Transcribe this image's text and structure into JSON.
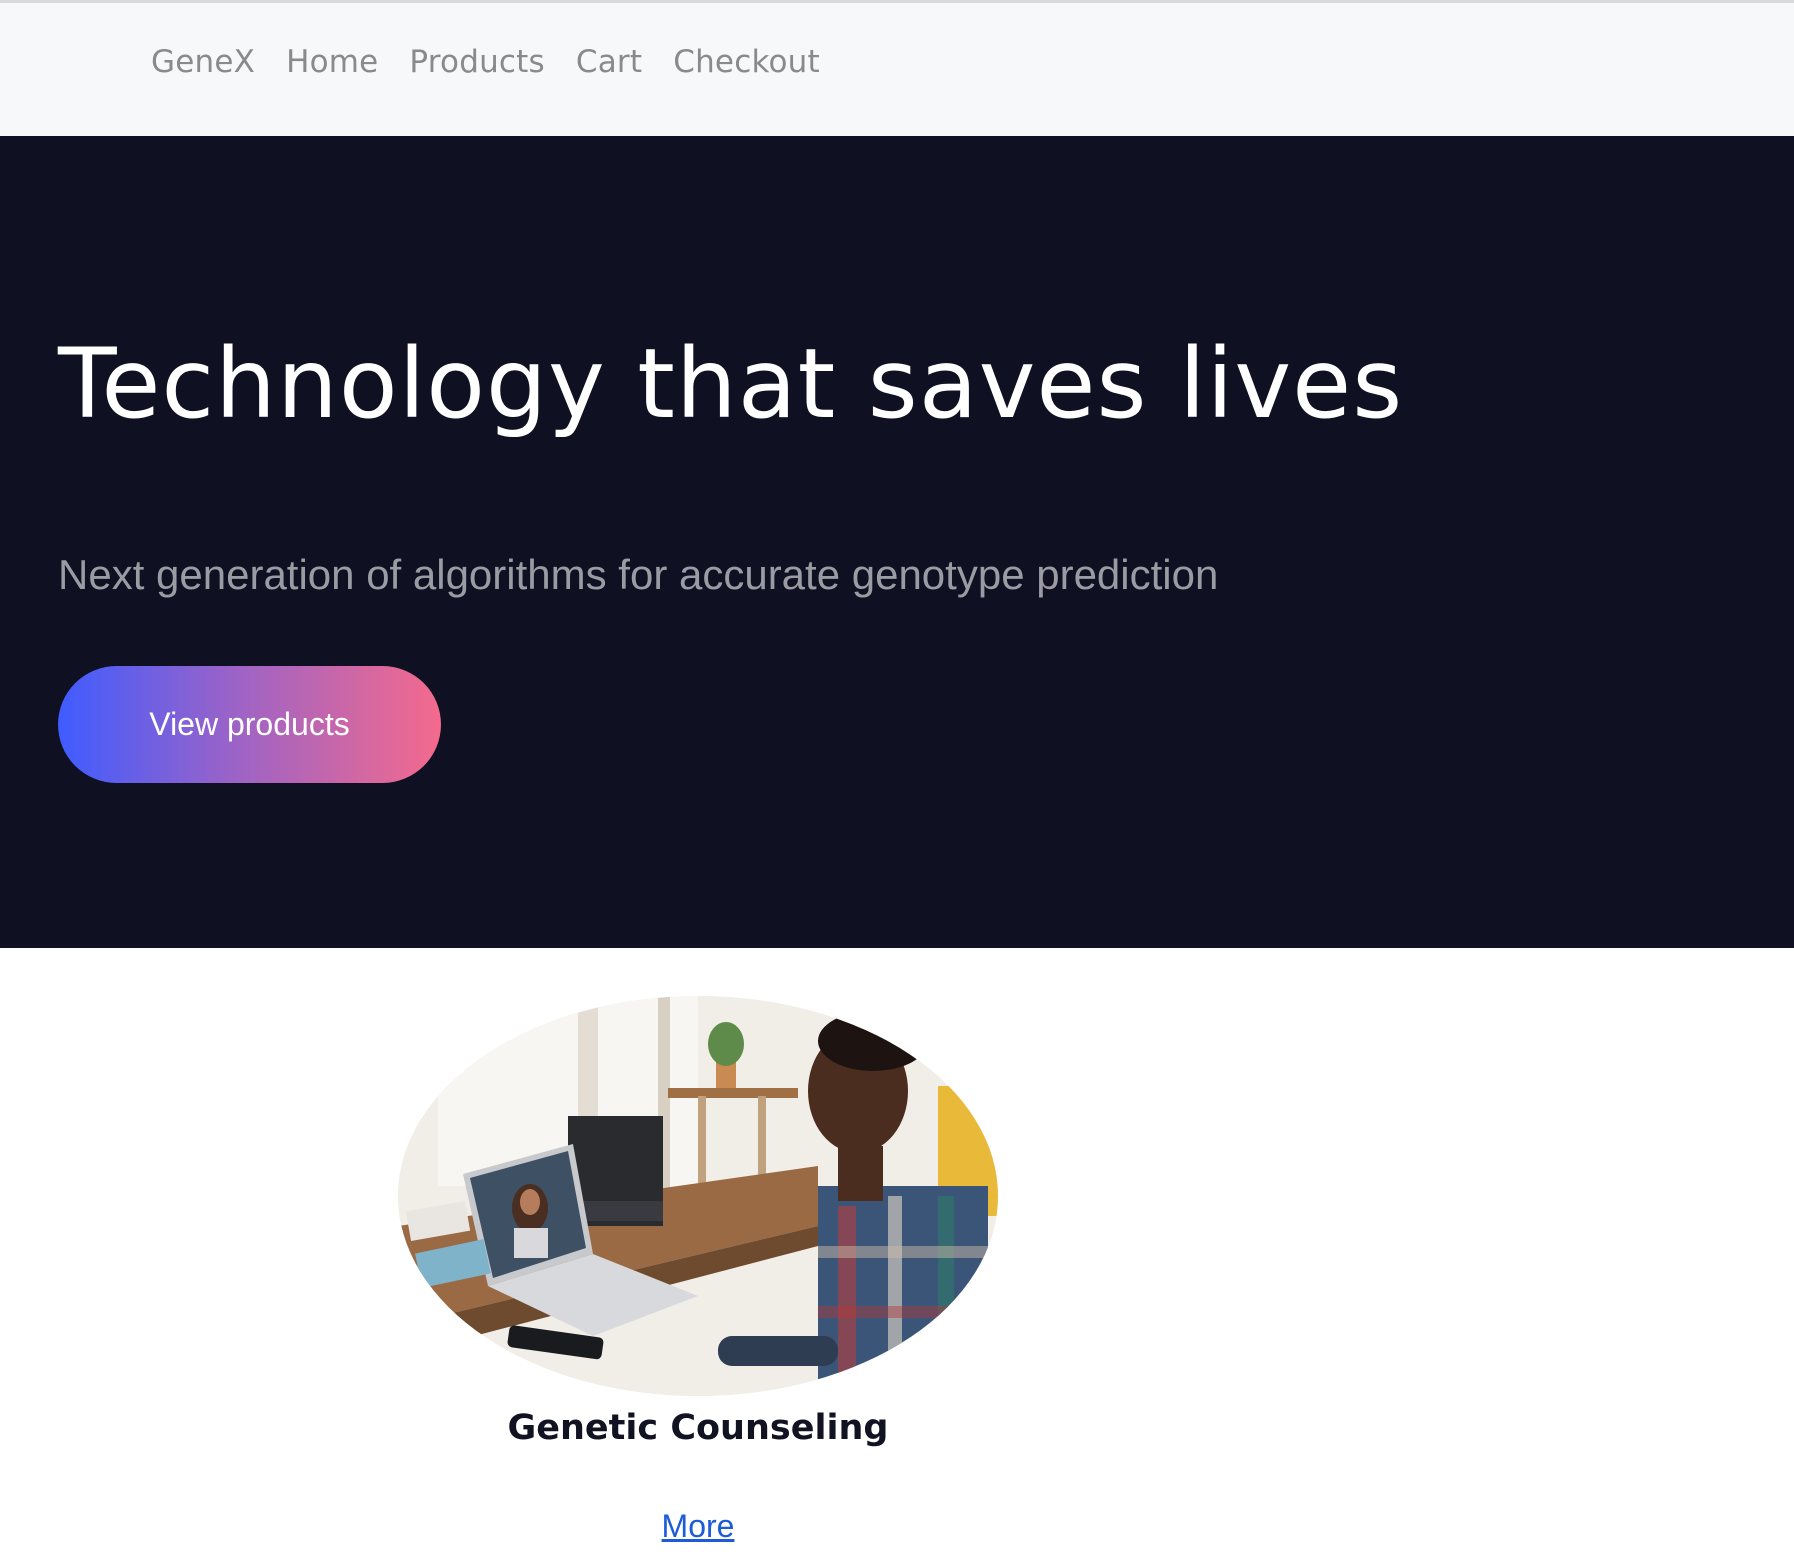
{
  "navbar": {
    "brand": "GeneX",
    "links": [
      "Home",
      "Products",
      "Cart",
      "Checkout"
    ]
  },
  "hero": {
    "title": "Technology that saves lives",
    "subtitle": "Next generation of algorithms for accurate genotype prediction",
    "button_label": "View products"
  },
  "service": {
    "title": "Genetic Counseling",
    "more_label": "More",
    "image_icon": "video-call-photo"
  },
  "colors": {
    "nav_bg": "#f7f8f9",
    "hero_bg": "#0f1022",
    "button_gradient_start": "#3f5cff",
    "button_gradient_end": "#f46a8c",
    "link": "#1e5bd8"
  }
}
